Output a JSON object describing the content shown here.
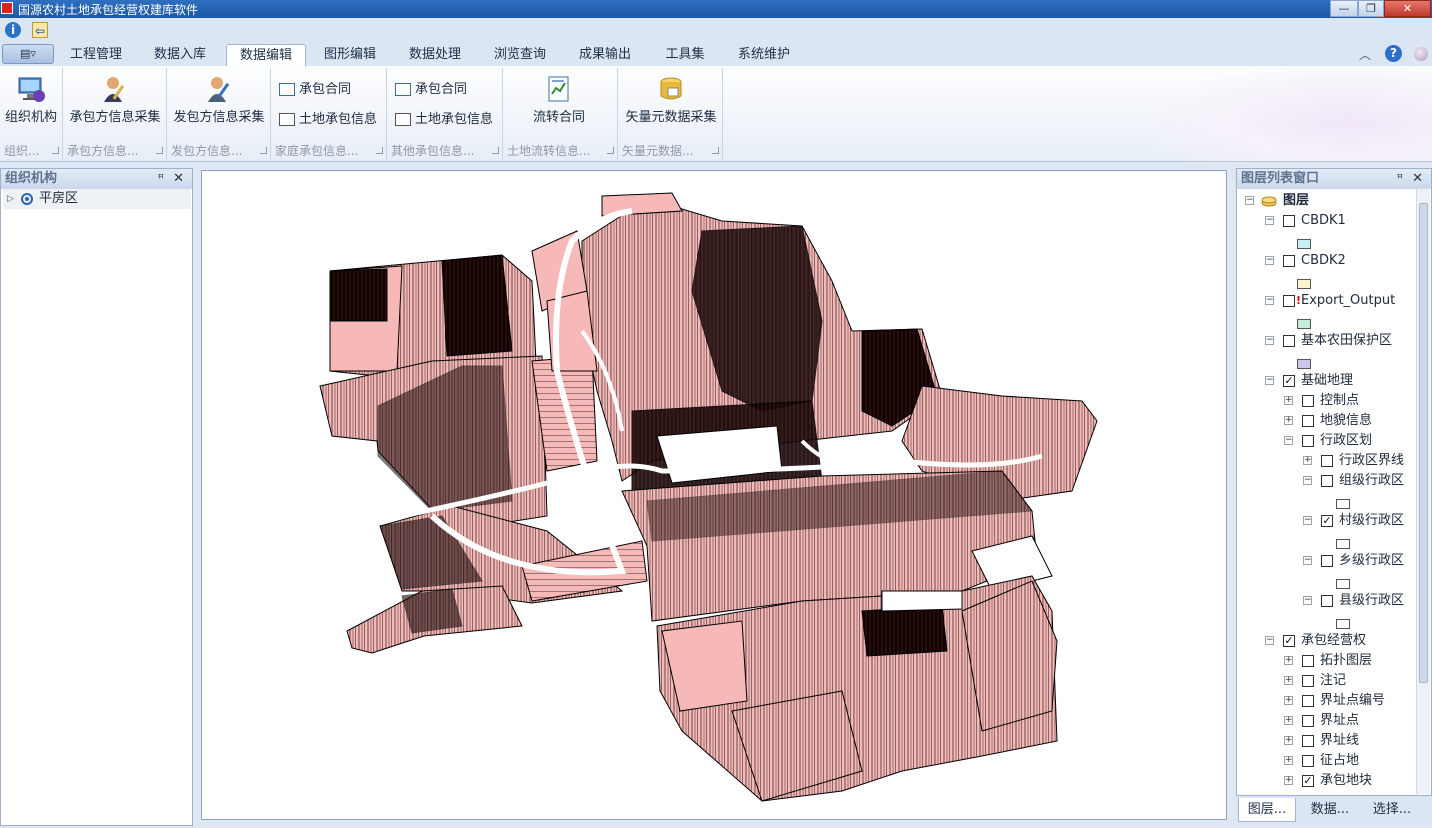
{
  "window": {
    "title": "国源农村土地承包经营权建库软件"
  },
  "tabs": [
    "工程管理",
    "数据入库",
    "数据编辑",
    "图形编辑",
    "数据处理",
    "浏览查询",
    "成果输出",
    "工具集",
    "系统维护"
  ],
  "active_tab": "数据编辑",
  "ribbon": {
    "groups": [
      {
        "caption": "组织...",
        "buttons": [
          "组织机构"
        ]
      },
      {
        "caption": "承包方信息...",
        "buttons": [
          "承包方信息采集"
        ]
      },
      {
        "caption": "发包方信息...",
        "buttons": [
          "发包方信息采集"
        ]
      },
      {
        "caption": "家庭承包信息...",
        "buttons": [
          "承包合同",
          "土地承包信息"
        ]
      },
      {
        "caption": "其他承包信息...",
        "buttons": [
          "承包合同",
          "土地承包信息"
        ]
      },
      {
        "caption": "土地流转信息...",
        "buttons": [
          "流转合同"
        ]
      },
      {
        "caption": "矢量元数据...",
        "buttons": [
          "矢量元数据采集"
        ]
      }
    ]
  },
  "left_panel": {
    "title": "组织机构",
    "tree": [
      "平房区"
    ]
  },
  "right_panel": {
    "title": "图层列表窗口",
    "root": "图层",
    "layers": [
      {
        "label": "CBDK1",
        "checked": false,
        "swatch": "#c8eef5"
      },
      {
        "label": "CBDK2",
        "checked": false,
        "swatch": "#fbf5cf"
      },
      {
        "label": "Export_Output",
        "checked": false,
        "swatch": "#c9ecd9"
      },
      {
        "label": "基本农田保护区",
        "checked": false,
        "swatch": "#cfc6ee"
      },
      {
        "label": "基础地理",
        "checked": true
      },
      {
        "label": "控制点",
        "checked": false
      },
      {
        "label": "地貌信息",
        "checked": false
      },
      {
        "label": "行政区划",
        "checked": false
      },
      {
        "label": "行政区界线",
        "checked": false
      },
      {
        "label": "组级行政区",
        "checked": false,
        "swatch": "#ffffff"
      },
      {
        "label": "村级行政区",
        "checked": true,
        "swatch": "#ffffff"
      },
      {
        "label": "乡级行政区",
        "checked": false,
        "swatch": "#ffffff"
      },
      {
        "label": "县级行政区",
        "checked": false,
        "swatch": "#ffffff"
      },
      {
        "label": "承包经营权",
        "checked": true
      },
      {
        "label": "拓扑图层",
        "checked": false
      },
      {
        "label": "注记",
        "checked": false
      },
      {
        "label": "界址点编号",
        "checked": false
      },
      {
        "label": "界址点",
        "checked": false
      },
      {
        "label": "界址线",
        "checked": false
      },
      {
        "label": "征占地",
        "checked": false
      },
      {
        "label": "承包地块",
        "checked": true
      }
    ]
  },
  "bottom_tabs": [
    "图层...",
    "数据...",
    "选择..."
  ],
  "map": {
    "fill_color": "#f7b9b7",
    "stroke_color": "#000000"
  }
}
